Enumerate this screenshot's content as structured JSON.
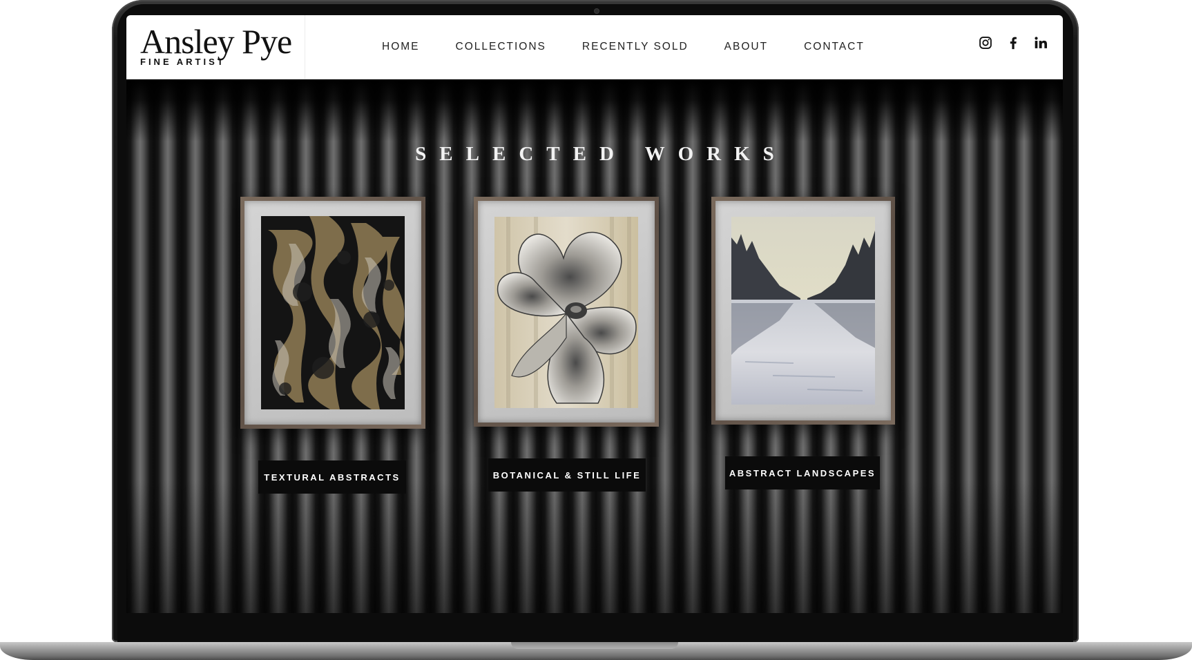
{
  "site": {
    "logo_name": "Ansley Pye",
    "logo_tagline": "FINE ARTIST"
  },
  "nav": {
    "items": [
      "HOME",
      "COLLECTIONS",
      "RECENTLY SOLD",
      "ABOUT",
      "CONTACT"
    ]
  },
  "social": [
    "instagram-icon",
    "facebook-icon",
    "linkedin-icon"
  ],
  "main": {
    "section_title": "SELECTED WORKS",
    "collections": [
      {
        "label": "TEXTURAL ABSTRACTS"
      },
      {
        "label": "BOTANICAL & STILL LIFE"
      },
      {
        "label": "ABSTRACT LANDSCAPES"
      }
    ]
  },
  "colors": {
    "header_bg": "#ffffff",
    "button_bg": "#0b0b0b",
    "button_text": "#ffffff",
    "title_text": "#f2f2f2"
  }
}
